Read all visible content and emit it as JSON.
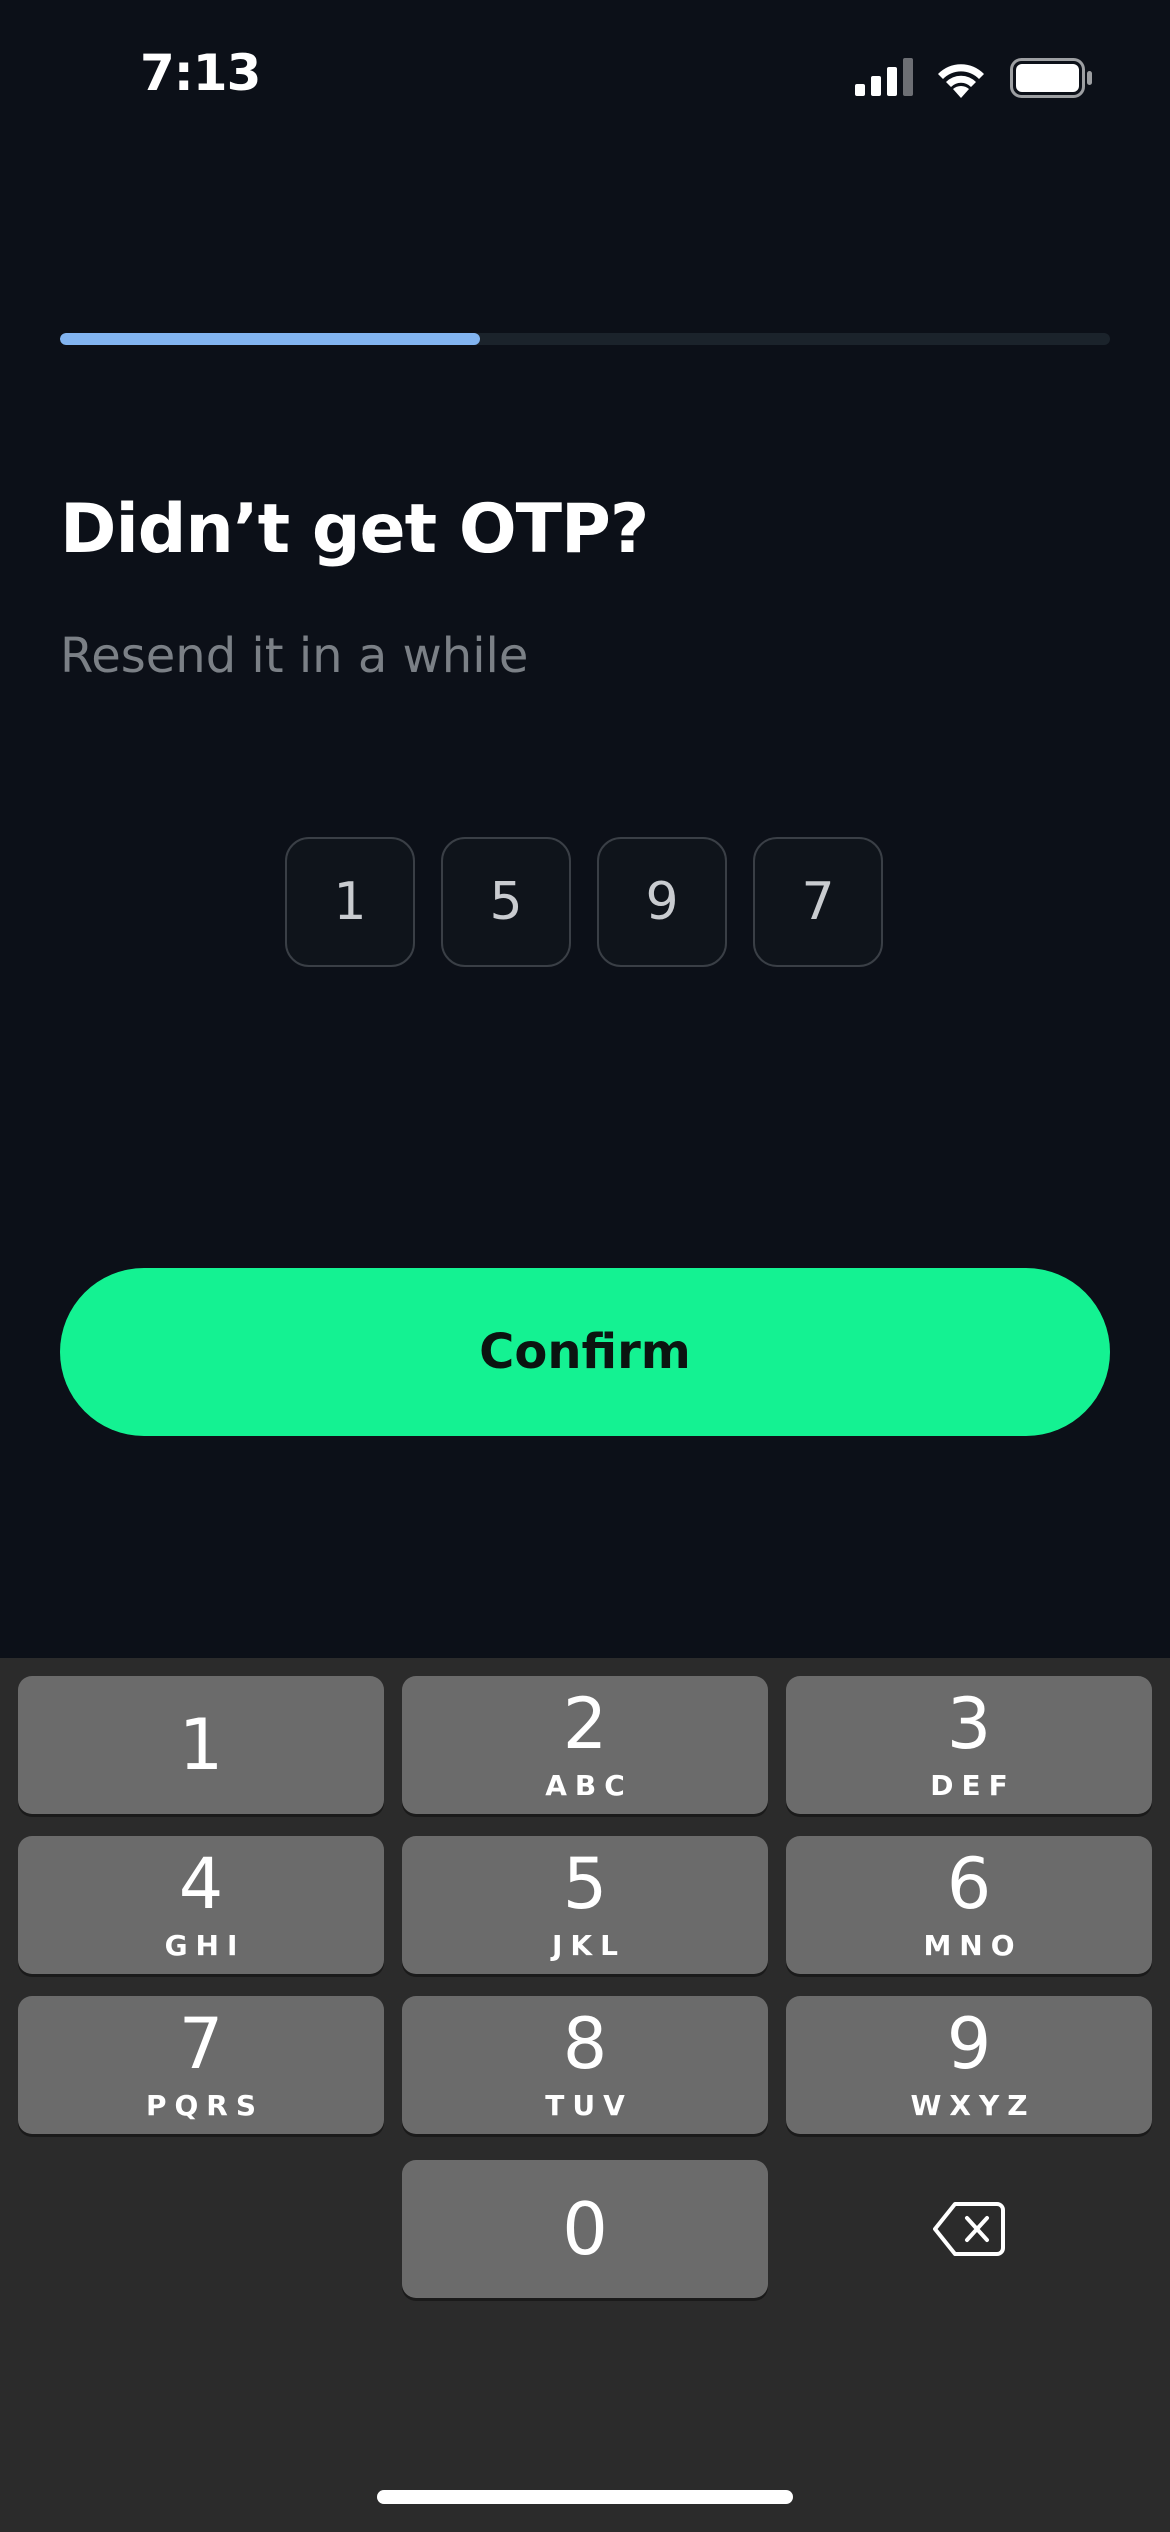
{
  "status_bar": {
    "time": "7:13"
  },
  "progress": {
    "fraction": 0.4
  },
  "screen": {
    "title": "Didn’t get OTP?",
    "subtitle": "Resend it in a while"
  },
  "otp": {
    "digits": [
      "1",
      "5",
      "9",
      "7"
    ]
  },
  "actions": {
    "confirm_label": "Confirm"
  },
  "keyboard": {
    "keys": [
      {
        "digit": "1",
        "letters": ""
      },
      {
        "digit": "2",
        "letters": "ABC"
      },
      {
        "digit": "3",
        "letters": "DEF"
      },
      {
        "digit": "4",
        "letters": "GHI"
      },
      {
        "digit": "5",
        "letters": "JKL"
      },
      {
        "digit": "6",
        "letters": "MNO"
      },
      {
        "digit": "7",
        "letters": "PQRS"
      },
      {
        "digit": "8",
        "letters": "TUV"
      },
      {
        "digit": "9",
        "letters": "WXYZ"
      },
      {
        "digit": "0",
        "letters": ""
      }
    ],
    "delete_icon": "backspace-icon"
  },
  "colors": {
    "background": "#0c1018",
    "progress_fill": "#82b4f0",
    "progress_track": "#1b232b",
    "accent": "#14f292",
    "key": "#6b6b6b",
    "keyboard_background": "#2b2b2b"
  }
}
